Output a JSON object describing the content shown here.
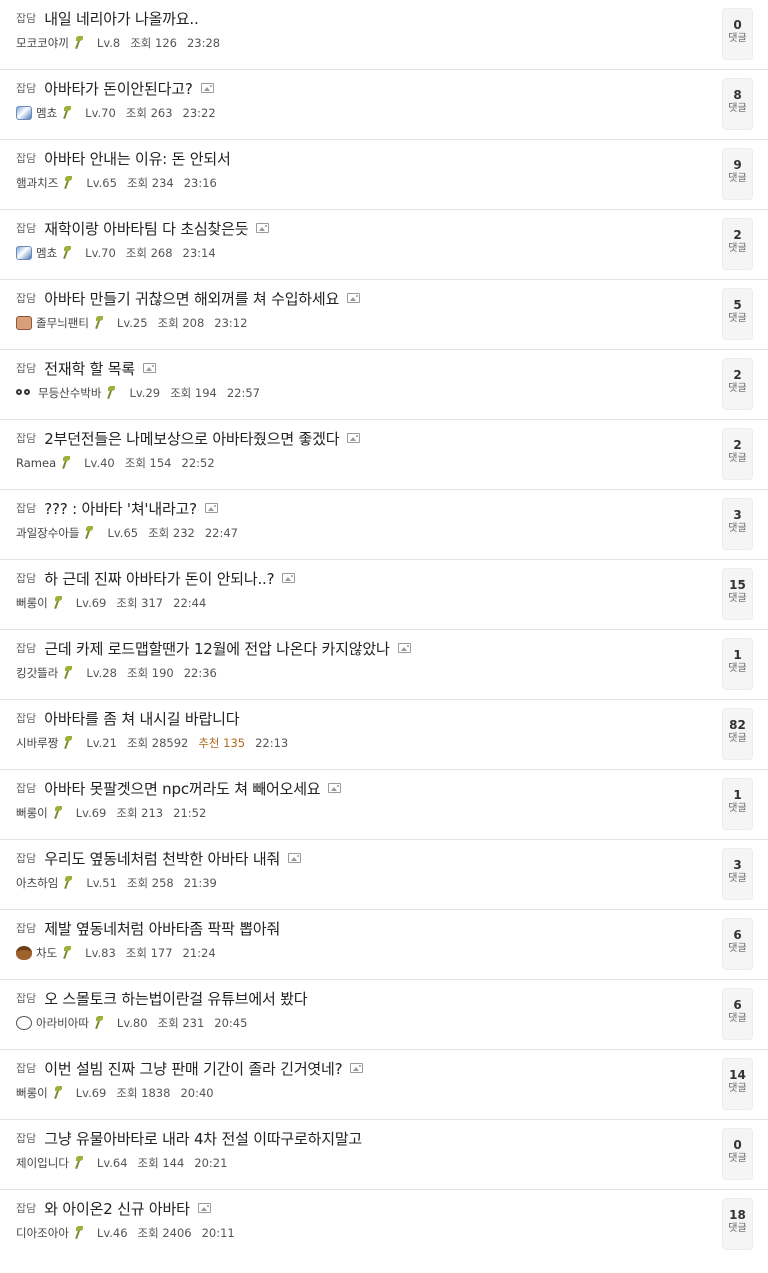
{
  "comment_label": "댓글",
  "posts": [
    {
      "category": "잡담",
      "title": "내일 네리아가 나올까요..",
      "has_image": false,
      "avatar": "",
      "author": "모코코야끼",
      "level": "Lv.8",
      "views": "조회 126",
      "recommend": "",
      "time": "23:28",
      "comments": "0"
    },
    {
      "category": "잡담",
      "title": "아바타가 돈이안된다고?",
      "has_image": true,
      "avatar": "helmet-avatar",
      "author": "멤쵸",
      "level": "Lv.70",
      "views": "조회 263",
      "recommend": "",
      "time": "23:22",
      "comments": "8"
    },
    {
      "category": "잡담",
      "title": "아바타 안내는 이유: 돈 안되서",
      "has_image": false,
      "avatar": "",
      "author": "햄과치즈",
      "level": "Lv.65",
      "views": "조회 234",
      "recommend": "",
      "time": "23:16",
      "comments": "9"
    },
    {
      "category": "잡담",
      "title": "재학이랑 아바타팀 다 초심찾은듯",
      "has_image": true,
      "avatar": "helmet-avatar",
      "author": "멤쵸",
      "level": "Lv.70",
      "views": "조회 268",
      "recommend": "",
      "time": "23:14",
      "comments": "2"
    },
    {
      "category": "잡담",
      "title": "아바타 만들기 귀찮으면 해외꺼를 쳐 수입하세요",
      "has_image": true,
      "avatar": "face-avatar",
      "author": "졸무늬팬티",
      "level": "Lv.25",
      "views": "조회 208",
      "recommend": "",
      "time": "23:12",
      "comments": "5"
    },
    {
      "category": "잡담",
      "title": "전재학 할 목록",
      "has_image": true,
      "avatar": "eyes-avatar",
      "author": "무등산수박바",
      "level": "Lv.29",
      "views": "조회 194",
      "recommend": "",
      "time": "22:57",
      "comments": "2"
    },
    {
      "category": "잡담",
      "title": "2부던전들은 나메보상으로 아바타줬으면 좋겠다",
      "has_image": true,
      "avatar": "",
      "author": "Ramea",
      "level": "Lv.40",
      "views": "조회 154",
      "recommend": "",
      "time": "22:52",
      "comments": "2"
    },
    {
      "category": "잡담",
      "title": "??? : 아바타 '쳐'내라고?",
      "has_image": true,
      "avatar": "",
      "author": "과일장수아들",
      "level": "Lv.65",
      "views": "조회 232",
      "recommend": "",
      "time": "22:47",
      "comments": "3"
    },
    {
      "category": "잡담",
      "title": "하 근데 진짜 아바타가 돈이 안되나..?",
      "has_image": true,
      "avatar": "",
      "author": "뻐롱이",
      "level": "Lv.69",
      "views": "조회 317",
      "recommend": "",
      "time": "22:44",
      "comments": "15"
    },
    {
      "category": "잡담",
      "title": "근데 카제 로드맵할땐가 12월에 전압 나온다 카지않았나",
      "has_image": true,
      "avatar": "",
      "author": "킹갓뜰라",
      "level": "Lv.28",
      "views": "조회 190",
      "recommend": "",
      "time": "22:36",
      "comments": "1"
    },
    {
      "category": "잡담",
      "title": "아바타를 좀 쳐 내시길 바랍니다",
      "has_image": false,
      "avatar": "",
      "author": "시바루짱",
      "level": "Lv.21",
      "views": "조회 28592",
      "recommend": "추천 135",
      "time": "22:13",
      "comments": "82"
    },
    {
      "category": "잡담",
      "title": "아바타 못팔겟으면 npc꺼라도 쳐 빼어오세요",
      "has_image": true,
      "avatar": "",
      "author": "뻐롱이",
      "level": "Lv.69",
      "views": "조회 213",
      "recommend": "",
      "time": "21:52",
      "comments": "1"
    },
    {
      "category": "잡담",
      "title": "우리도 옆동네처럼 천박한 아바타 내줘",
      "has_image": true,
      "avatar": "",
      "author": "아츠하임",
      "level": "Lv.51",
      "views": "조회 258",
      "recommend": "",
      "time": "21:39",
      "comments": "3"
    },
    {
      "category": "잡담",
      "title": "제발 옆동네처럼 아바타좀 팍팍 뽑아줘",
      "has_image": false,
      "avatar": "acorn-avatar",
      "author": "차도",
      "level": "Lv.83",
      "views": "조회 177",
      "recommend": "",
      "time": "21:24",
      "comments": "6"
    },
    {
      "category": "잡담",
      "title": "오 스몰토크 하는법이란걸 유튜브에서 봤다",
      "has_image": false,
      "avatar": "ghost-avatar",
      "author": "아라비아따",
      "level": "Lv.80",
      "views": "조회 231",
      "recommend": "",
      "time": "20:45",
      "comments": "6"
    },
    {
      "category": "잡담",
      "title": "이번 설빔 진짜 그냥 판매 기간이 졸라 긴거엿네?",
      "has_image": true,
      "avatar": "",
      "author": "뻐롱이",
      "level": "Lv.69",
      "views": "조회 1838",
      "recommend": "",
      "time": "20:40",
      "comments": "14"
    },
    {
      "category": "잡담",
      "title": "그냥 유물아바타로 내라 4차 전설 이따구로하지말고",
      "has_image": false,
      "avatar": "",
      "author": "제이입니다",
      "level": "Lv.64",
      "views": "조회 144",
      "recommend": "",
      "time": "20:21",
      "comments": "0"
    },
    {
      "category": "잡담",
      "title": "와 아이온2 신규 아바타",
      "has_image": true,
      "avatar": "",
      "author": "디아조아아",
      "level": "Lv.46",
      "views": "조회 2406",
      "recommend": "",
      "time": "20:11",
      "comments": "18"
    }
  ]
}
